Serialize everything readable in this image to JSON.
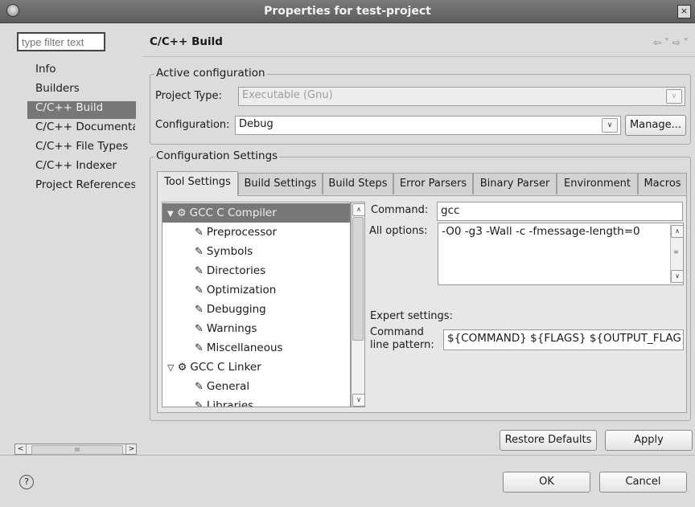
{
  "window": {
    "title": "Properties for test-project",
    "close_glyph": "×"
  },
  "left": {
    "filter_placeholder": "type filter text",
    "nav_items": [
      "Info",
      "Builders",
      "C/C++ Build",
      "C/C++ Documentation",
      "C/C++ File Types",
      "C/C++ Indexer",
      "Project References"
    ],
    "selected_index": 2,
    "scroll_thumb": "III"
  },
  "page": {
    "title": "C/C++ Build",
    "nav_back": "⇦ ˅",
    "nav_forward": "⇨ ˅"
  },
  "active_configuration": {
    "legend": "Active configuration",
    "project_type_label": "Project Type:",
    "project_type_value": "Executable (Gnu)",
    "configuration_label": "Configuration:",
    "configuration_value": "Debug",
    "manage_button": "Manage..."
  },
  "configuration_settings": {
    "legend": "Configuration Settings",
    "tabs": [
      "Tool Settings",
      "Build Settings",
      "Build Steps",
      "Error Parsers",
      "Binary Parser",
      "Environment",
      "Macros"
    ],
    "active_tab": 0
  },
  "tree": {
    "items": [
      {
        "label": "GCC C Compiler",
        "icon": "gear-icon",
        "expand": "▼",
        "selected": true
      },
      {
        "label": "Preprocessor",
        "icon": "settings-page-icon"
      },
      {
        "label": "Symbols",
        "icon": "settings-page-icon"
      },
      {
        "label": "Directories",
        "icon": "settings-page-icon"
      },
      {
        "label": "Optimization",
        "icon": "settings-page-icon"
      },
      {
        "label": "Debugging",
        "icon": "settings-page-icon"
      },
      {
        "label": "Warnings",
        "icon": "settings-page-icon"
      },
      {
        "label": "Miscellaneous",
        "icon": "settings-page-icon"
      },
      {
        "label": "GCC C Linker",
        "icon": "gear-icon",
        "expand": "▽"
      },
      {
        "label": "General",
        "icon": "settings-page-icon"
      },
      {
        "label": "Libraries",
        "icon": "settings-page-icon"
      }
    ]
  },
  "tool_settings": {
    "command_label": "Command:",
    "command_value": "gcc",
    "all_options_label": "All options:",
    "all_options_value": "-O0 -g3 -Wall -c -fmessage-length=0",
    "expert_label": "Expert settings:",
    "pattern_label_line1": "Command",
    "pattern_label_line2": "line pattern:",
    "pattern_value": "${COMMAND} ${FLAGS} ${OUTPUT_FLAG}"
  },
  "buttons": {
    "restore_defaults": "Restore Defaults",
    "apply": "Apply",
    "ok": "OK",
    "cancel": "Cancel",
    "help": "?"
  }
}
